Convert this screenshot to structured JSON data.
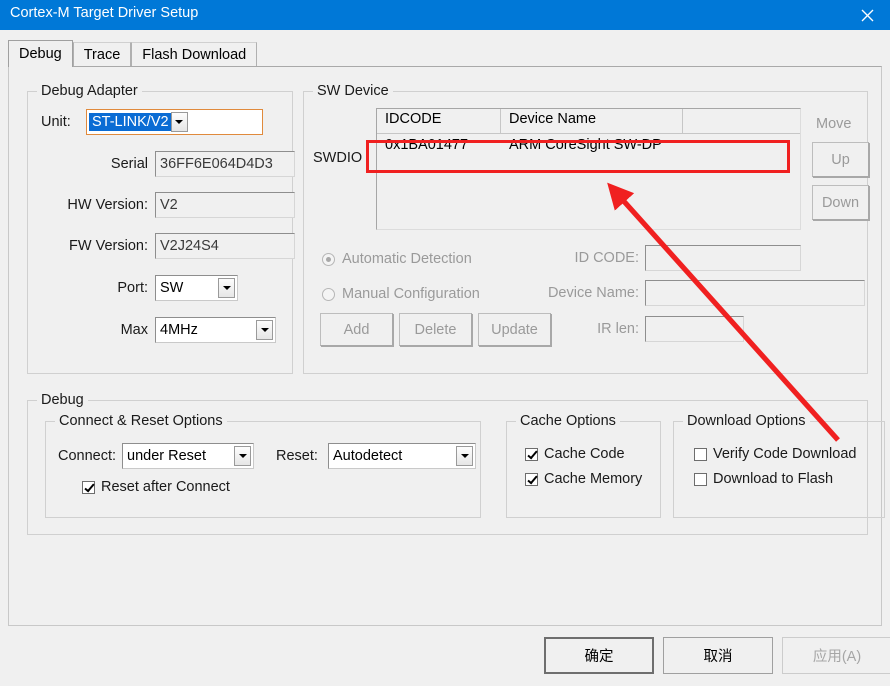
{
  "window": {
    "title": "Cortex-M Target Driver Setup",
    "close_icon": "close-icon",
    "titlebar_color": "#0078D7"
  },
  "tabs": [
    {
      "label": "Debug",
      "active": true
    },
    {
      "label": "Trace",
      "active": false
    },
    {
      "label": "Flash Download",
      "active": false
    }
  ],
  "debug_adapter": {
    "group_label": "Debug Adapter",
    "unit_label": "Unit:",
    "unit_value": "ST-LINK/V2",
    "serial_label": "Serial",
    "serial_value": "36FF6E064D4D3",
    "hw_version_label": "HW Version:",
    "hw_version_value": "V2",
    "fw_version_label": "FW Version:",
    "fw_version_value": "V2J24S4",
    "port_label": "Port:",
    "port_value": "SW",
    "max_label": "Max",
    "max_value": "4MHz"
  },
  "sw_device": {
    "group_label": "SW Device",
    "swdio_label": "SWDIO",
    "columns": [
      "IDCODE",
      "Device Name",
      ""
    ],
    "rows": [
      {
        "idcode": "0x1BA01477",
        "device_name": "ARM CoreSight SW-DP",
        "extra": ""
      }
    ],
    "move_label": "Move",
    "up_label": "Up",
    "down_label": "Down",
    "automatic_detection_label": "Automatic Detection",
    "manual_configuration_label": "Manual Configuration",
    "detection_mode": "automatic",
    "id_code_label": "ID CODE:",
    "id_code_value": "",
    "device_name_label": "Device Name:",
    "device_name_value": "",
    "ir_len_label": "IR len:",
    "ir_len_value": "",
    "add_label": "Add",
    "delete_label": "Delete",
    "update_label": "Update"
  },
  "debug": {
    "group_label": "Debug",
    "connect_reset": {
      "group_label": "Connect & Reset Options",
      "connect_label": "Connect:",
      "connect_value": "under Reset",
      "reset_label": "Reset:",
      "reset_value": "Autodetect",
      "reset_after_connect_label": "Reset after Connect",
      "reset_after_connect_checked": true
    },
    "cache": {
      "group_label": "Cache Options",
      "cache_code_label": "Cache Code",
      "cache_code_checked": true,
      "cache_memory_label": "Cache Memory",
      "cache_memory_checked": true
    },
    "download": {
      "group_label": "Download Options",
      "verify_code_download_label": "Verify Code Download",
      "verify_code_download_checked": false,
      "download_to_flash_label": "Download to Flash",
      "download_to_flash_checked": false
    }
  },
  "footer": {
    "ok_label": "确定",
    "cancel_label": "取消",
    "apply_label": "应用(A)"
  },
  "annotation": {
    "highlight_color": "#f02020",
    "arrow_color": "#f02020",
    "target": "sw-device-row-0"
  }
}
